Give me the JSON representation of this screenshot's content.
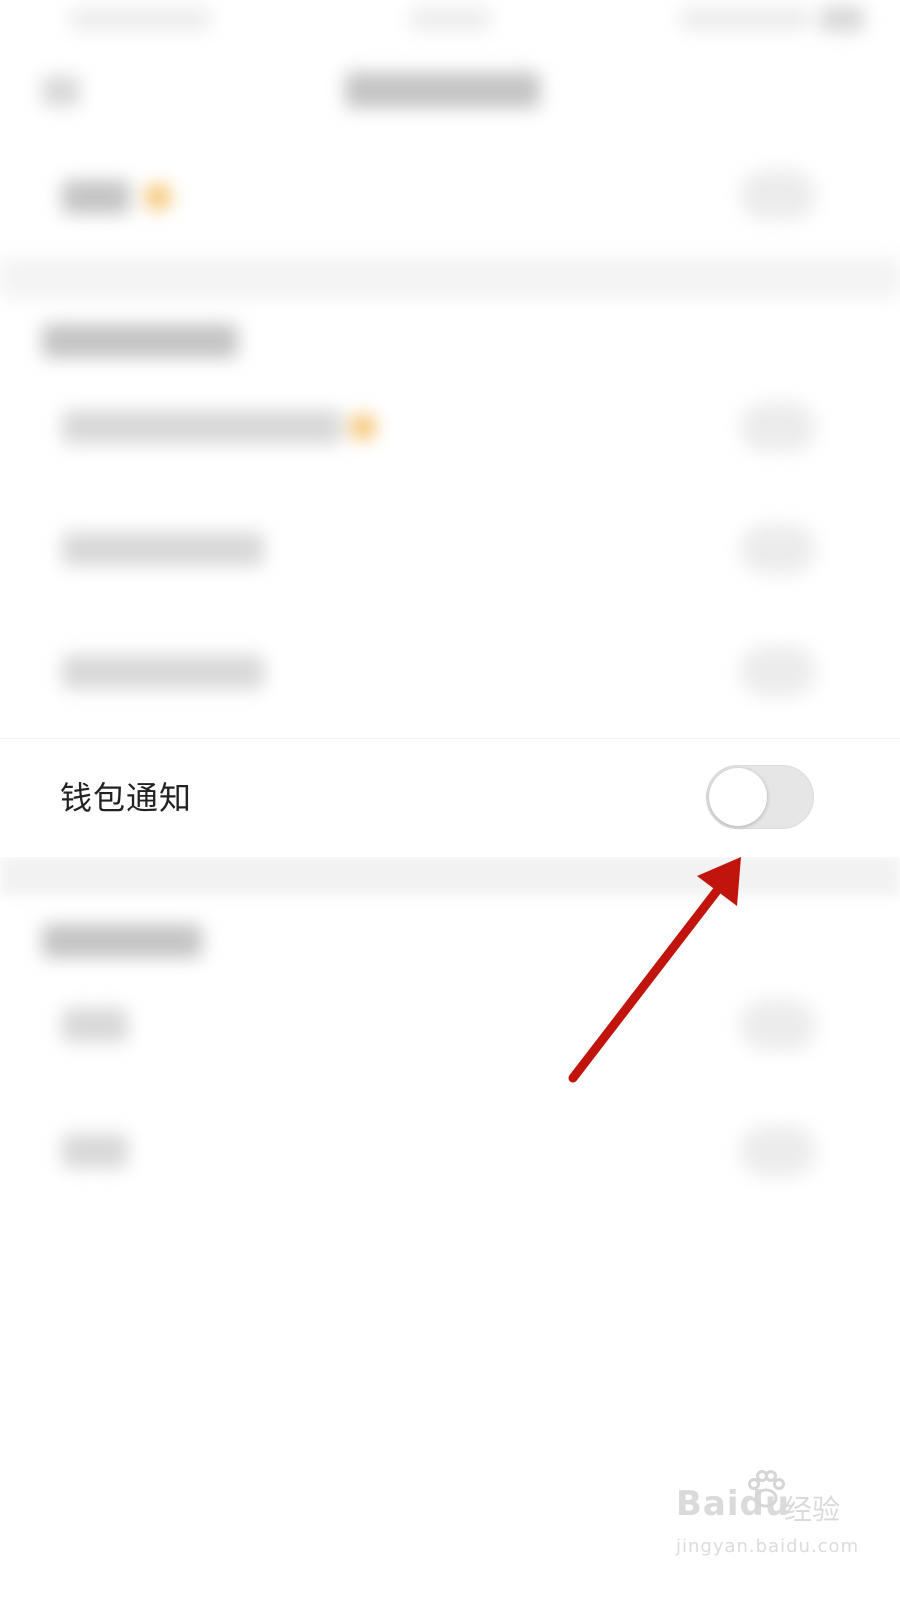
{
  "setting": {
    "label": "钱包通知",
    "toggle_state": "off"
  },
  "colors": {
    "annotation_arrow": "#c0140c",
    "toggle_track": "#e6e6e6",
    "accent_blurred": "#f4c26b"
  },
  "watermark": {
    "logo": "Baidu",
    "cn": "经验",
    "url": "jingyan.baidu.com"
  }
}
